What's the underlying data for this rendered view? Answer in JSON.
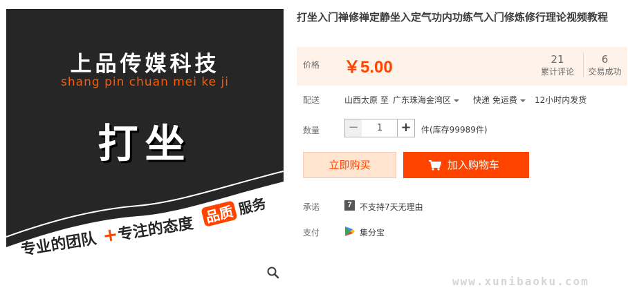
{
  "product_image": {
    "brand_cn": "上品传媒科技",
    "brand_en": "shang pin chuan mei ke ji",
    "main_word": "打坐",
    "banner_left": "专业的团队",
    "banner_plus": "+",
    "banner_right": "专注的态度",
    "badge_text": "品质",
    "badge_after": "服务",
    "zoom_icon": "magnifier-icon"
  },
  "title": "打坐入门禅修禅定静坐入定气功内功练气入门修炼修行理论视频教程",
  "price": {
    "label": "价格",
    "value": "￥5.00",
    "reviews_count": "21",
    "reviews_label": "累计评论",
    "sales_count": "6",
    "sales_label": "交易成功"
  },
  "shipping": {
    "label": "配送",
    "from": "山西太原 至",
    "to": "广东珠海金湾区",
    "method": "快递 免运费",
    "dispatch": "12小时内发货"
  },
  "quantity": {
    "label": "数量",
    "minus": "−",
    "value": "1",
    "plus": "+",
    "stock": "件(库存99989件)"
  },
  "actions": {
    "buy_now": "立即购买",
    "add_to_cart": "加入购物车",
    "cart_icon": "shopping-cart-icon"
  },
  "promise": {
    "label": "承诺",
    "icon_text": "7",
    "text": "不支持7天无理由"
  },
  "payment": {
    "label": "支付",
    "icon": "play-store-icon",
    "text": "集分宝"
  },
  "watermark": "www.xunibaoku.com",
  "colors": {
    "accent": "#ff4400",
    "price_bg": "#fff2e8",
    "image_bg": "#262626",
    "brand_orange": "#ff5a00"
  }
}
